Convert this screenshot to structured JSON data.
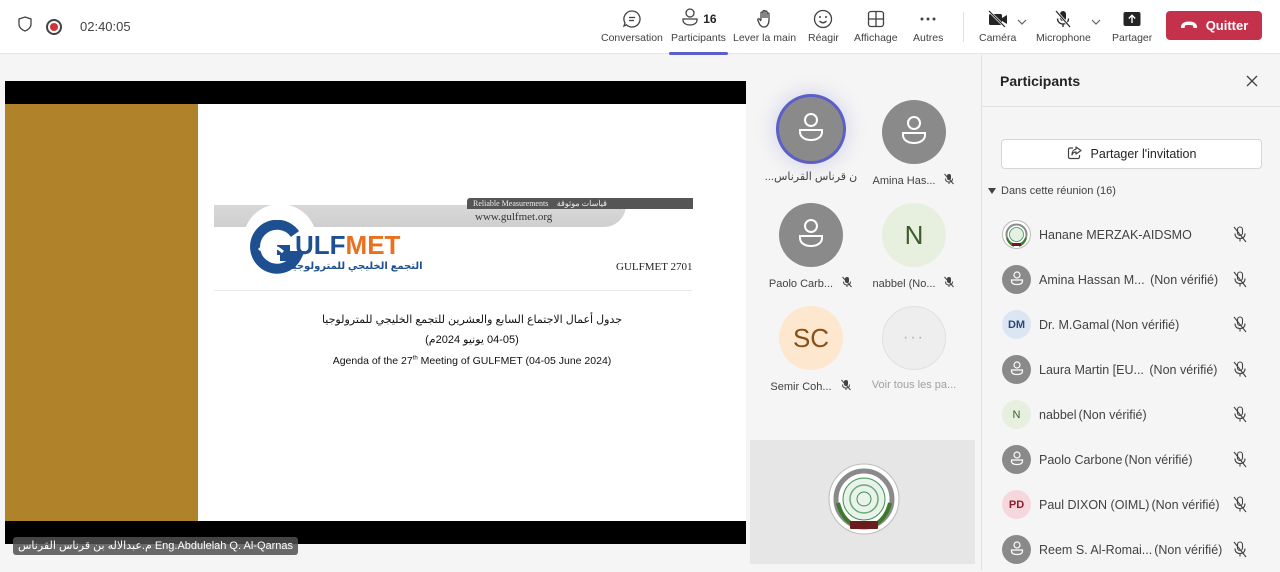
{
  "topbar": {
    "timer": "02:40:05",
    "icons": {
      "shield": "shield-icon",
      "recording": "recording-icon"
    },
    "buttons": [
      {
        "id": "conversation",
        "label": "Conversation",
        "icon": "chat-icon"
      },
      {
        "id": "participants",
        "label": "Participants",
        "icon": "people-icon",
        "count": "16",
        "active": true
      },
      {
        "id": "raise-hand",
        "label": "Lever la main",
        "icon": "hand-icon"
      },
      {
        "id": "react",
        "label": "Réagir",
        "icon": "smiley-icon"
      },
      {
        "id": "view",
        "label": "Affichage",
        "icon": "grid-icon"
      },
      {
        "id": "more",
        "label": "Autres",
        "icon": "more-icon"
      },
      {
        "id": "camera",
        "label": "Caméra",
        "icon": "camera-off-icon"
      },
      {
        "id": "microphone",
        "label": "Microphone",
        "icon": "mic-off-icon"
      },
      {
        "id": "share",
        "label": "Partager",
        "icon": "share-icon"
      }
    ],
    "quit_label": "Quitter",
    "quit_color": "#c4314b",
    "accent": "#5b5fc7"
  },
  "shared_screen": {
    "presenter_tag": "م.عبدالاله بن قرناس القرناس Eng.Abdulelah Q. Al-Qarnas",
    "slide": {
      "tagline_en": "Reliable Measurements",
      "tagline_ar": "قياسات موثوقة",
      "url": "www.gulfmet.org",
      "logo_word_a": "ULF",
      "logo_word_b": "MET",
      "logo_ar": "التجمع الخليجي للمترولوجيا",
      "doc_code": "GULFMET 2701",
      "agenda_ar_line1": "جدول أعمال الاجتماع السابع والعشرين للتجمع الخليجي للمترولوجيا",
      "agenda_ar_line2": "(04-05 يونيو 2024م)",
      "agenda_en_pre": "Agenda of the 27",
      "agenda_en_sup": "th",
      "agenda_en_post": " Meeting of GULFMET (04-05 June 2024)",
      "left_panel_color": "#b0822a"
    }
  },
  "gallery": {
    "tiles": [
      {
        "name": "...ن قرناس القرناس",
        "avatar": "person-icon",
        "speaking": true,
        "muted": false
      },
      {
        "name": "Amina Has...",
        "avatar": "person-icon",
        "muted": true
      },
      {
        "name": "Paolo Carb...",
        "avatar": "person-icon",
        "muted": true
      },
      {
        "name": "nabbel (No...",
        "initials": "N",
        "muted": true
      },
      {
        "name": "Semir Coh...",
        "initials": "SC",
        "muted": true
      },
      {
        "name": "Voir tous les pa...",
        "initials": "···",
        "muted": false
      }
    ],
    "self_view_icon": "aidsmo-emblem"
  },
  "panel": {
    "title": "Participants",
    "invite_label": "Partager l'invitation",
    "section_label": "Dans cette réunion (16)",
    "participants": [
      {
        "name": "Hanane MERZAK-AIDSMO",
        "status": "",
        "avatar": "emblem",
        "muted": true
      },
      {
        "name": "Amina Hassan M...",
        "status": " (Non vérifié)",
        "avatar": "person",
        "muted": true
      },
      {
        "name": "Dr. M.Gamal",
        "status": "(Non vérifié)",
        "avatar": "initials",
        "initials": "DM",
        "muted": true
      },
      {
        "name": "Laura Martin [EU...",
        "status": " (Non vérifié)",
        "avatar": "person",
        "muted": true
      },
      {
        "name": "nabbel",
        "status": "(Non vérifié)",
        "avatar": "initials",
        "initials": "N",
        "muted": true
      },
      {
        "name": "Paolo Carbone",
        "status": "(Non vérifié)",
        "avatar": "person",
        "muted": true
      },
      {
        "name": "Paul DIXON (OIML)",
        "status": "(Non vérifié)",
        "avatar": "initials",
        "initials": "PD",
        "muted": true
      },
      {
        "name": "Reem S. Al-Romai...",
        "status": "(Non vérifié)",
        "avatar": "person",
        "muted": true
      }
    ]
  }
}
